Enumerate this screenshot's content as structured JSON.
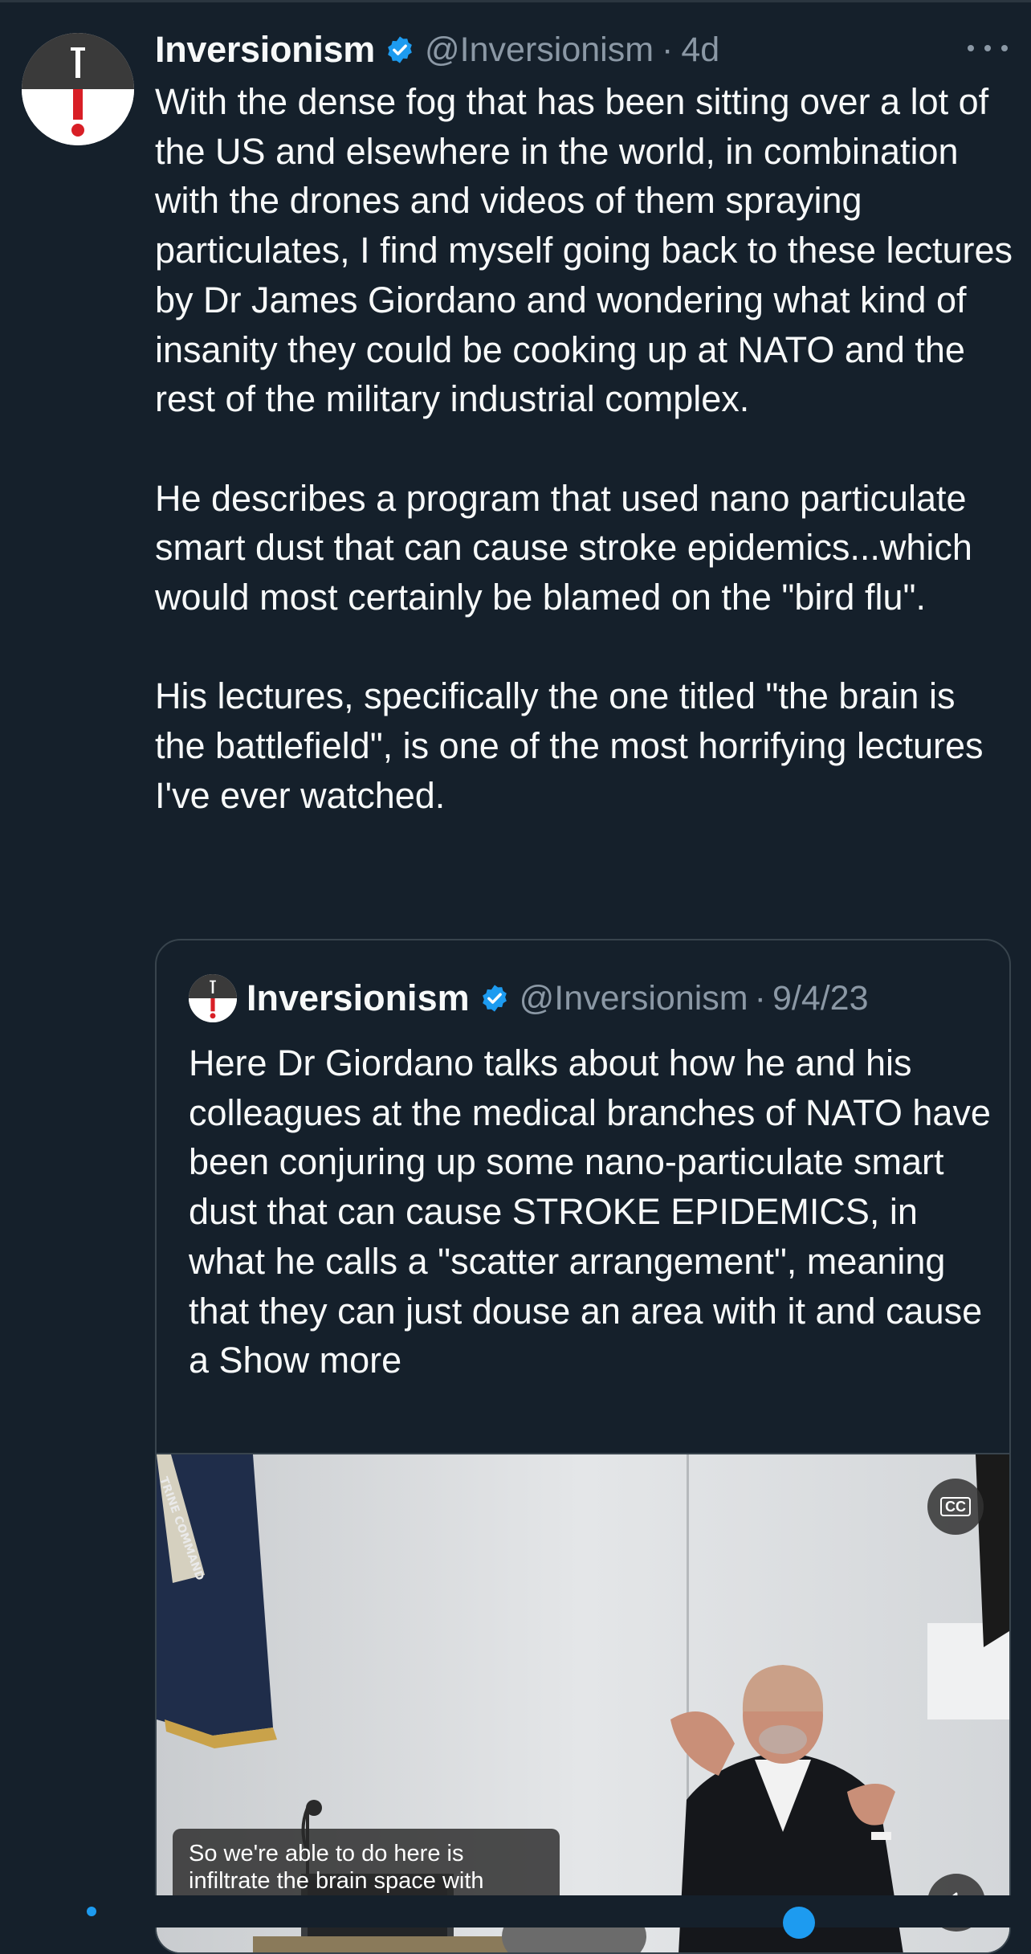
{
  "colors": {
    "background": "#15202b",
    "text_primary": "#f7f9f9",
    "text_secondary": "#8b98a5",
    "border": "#38444d",
    "verified_blue": "#1d9bf0",
    "avatar_red": "#d81f26"
  },
  "icons": {
    "verified": "verified-badge-icon",
    "more": "more-options-icon",
    "captions": "closed-captions-icon",
    "mute": "muted-speaker-icon"
  },
  "tweet": {
    "author": {
      "display_name": "Inversionism",
      "handle": "@Inversionism"
    },
    "separator": "·",
    "timestamp": "4d",
    "paragraphs": [
      "With the dense fog that has been sitting over a lot of the US and elsewhere in the world, in combination with the drones and videos of them spraying particulates, I find myself going back to these lectures by Dr James Giordano and wondering what kind of insanity they could be cooking up at NATO and the rest of the military industrial complex.",
      "He describes a program that used nano particulate smart dust that can cause stroke epidemics...which would most certainly be blamed on the \"bird flu\".",
      "His lectures, specifically the one titled \"the brain is the battlefield\", is one of the most horrifying lectures I've ever watched."
    ]
  },
  "quoted_tweet": {
    "author": {
      "display_name": "Inversionism",
      "handle": "@Inversionism"
    },
    "separator": "·",
    "timestamp": "9/4/23",
    "text": "Here Dr Giordano talks about how he and his colleagues at the medical branches of NATO have been conjuring up some nano-particulate smart dust that can cause STROKE EPIDEMICS, in what he calls a \"scatter arrangement\", meaning that they can just douse an area with it and cause a",
    "show_more_label": "Show more",
    "video": {
      "cc_label": "CC",
      "caption_lines": [
        "So we're able to do here is",
        "infiltrate the brain space with"
      ],
      "flag_text": "TRINE  COMMAND"
    }
  }
}
